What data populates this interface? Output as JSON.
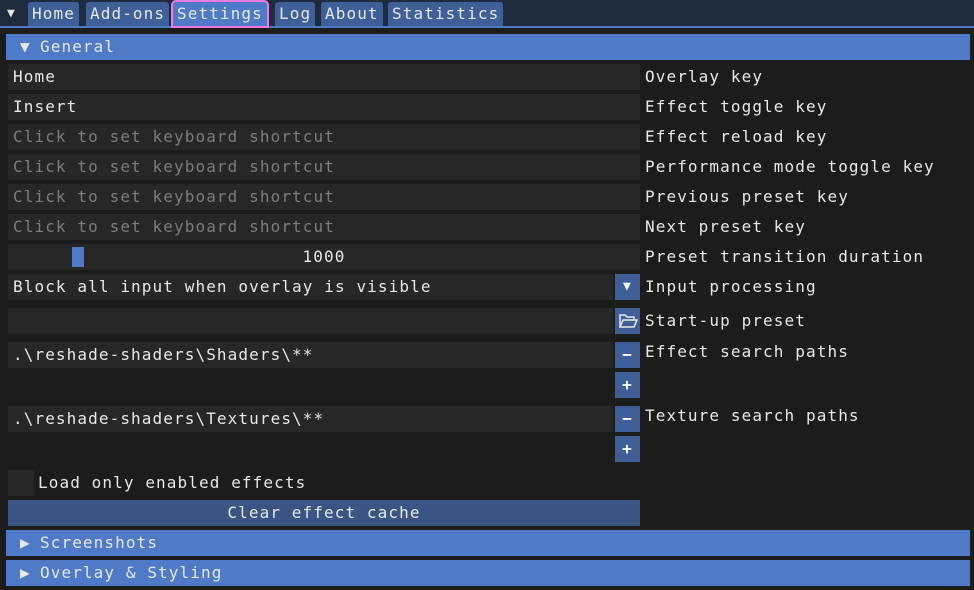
{
  "tabs": [
    "Home",
    "Add-ons",
    "Settings",
    "Log",
    "About",
    "Statistics"
  ],
  "active_tab": "Settings",
  "sections": {
    "general": "General",
    "screenshots": "Screenshots",
    "overlay": "Overlay & Styling"
  },
  "settings": {
    "overlay_key": {
      "value": "Home",
      "label": "Overlay key"
    },
    "effect_toggle_key": {
      "value": "Insert",
      "label": "Effect toggle key"
    },
    "effect_reload_key": {
      "placeholder": "Click to set keyboard shortcut",
      "label": "Effect reload key"
    },
    "performance_key": {
      "placeholder": "Click to set keyboard shortcut",
      "label": "Performance mode toggle key"
    },
    "previous_preset_key": {
      "placeholder": "Click to set keyboard shortcut",
      "label": "Previous preset key"
    },
    "next_preset_key": {
      "placeholder": "Click to set keyboard shortcut",
      "label": "Next preset key"
    },
    "transition": {
      "value": "1000",
      "label": "Preset transition duration"
    },
    "input_processing": {
      "value": "Block all input when overlay is visible",
      "label": "Input processing"
    },
    "startup_preset": {
      "value": "",
      "label": "Start-up preset"
    },
    "effect_paths": {
      "values": [
        ".\\reshade-shaders\\Shaders\\**"
      ],
      "label": "Effect search paths"
    },
    "texture_paths": {
      "values": [
        ".\\reshade-shaders\\Textures\\**"
      ],
      "label": "Texture search paths"
    },
    "load_only_enabled": {
      "checked": false,
      "label": "Load only enabled effects"
    },
    "clear_cache": "Clear effect cache"
  },
  "colors": {
    "accent": "#4f7ac8",
    "frame": "#272727",
    "background": "#1c1c1c"
  }
}
